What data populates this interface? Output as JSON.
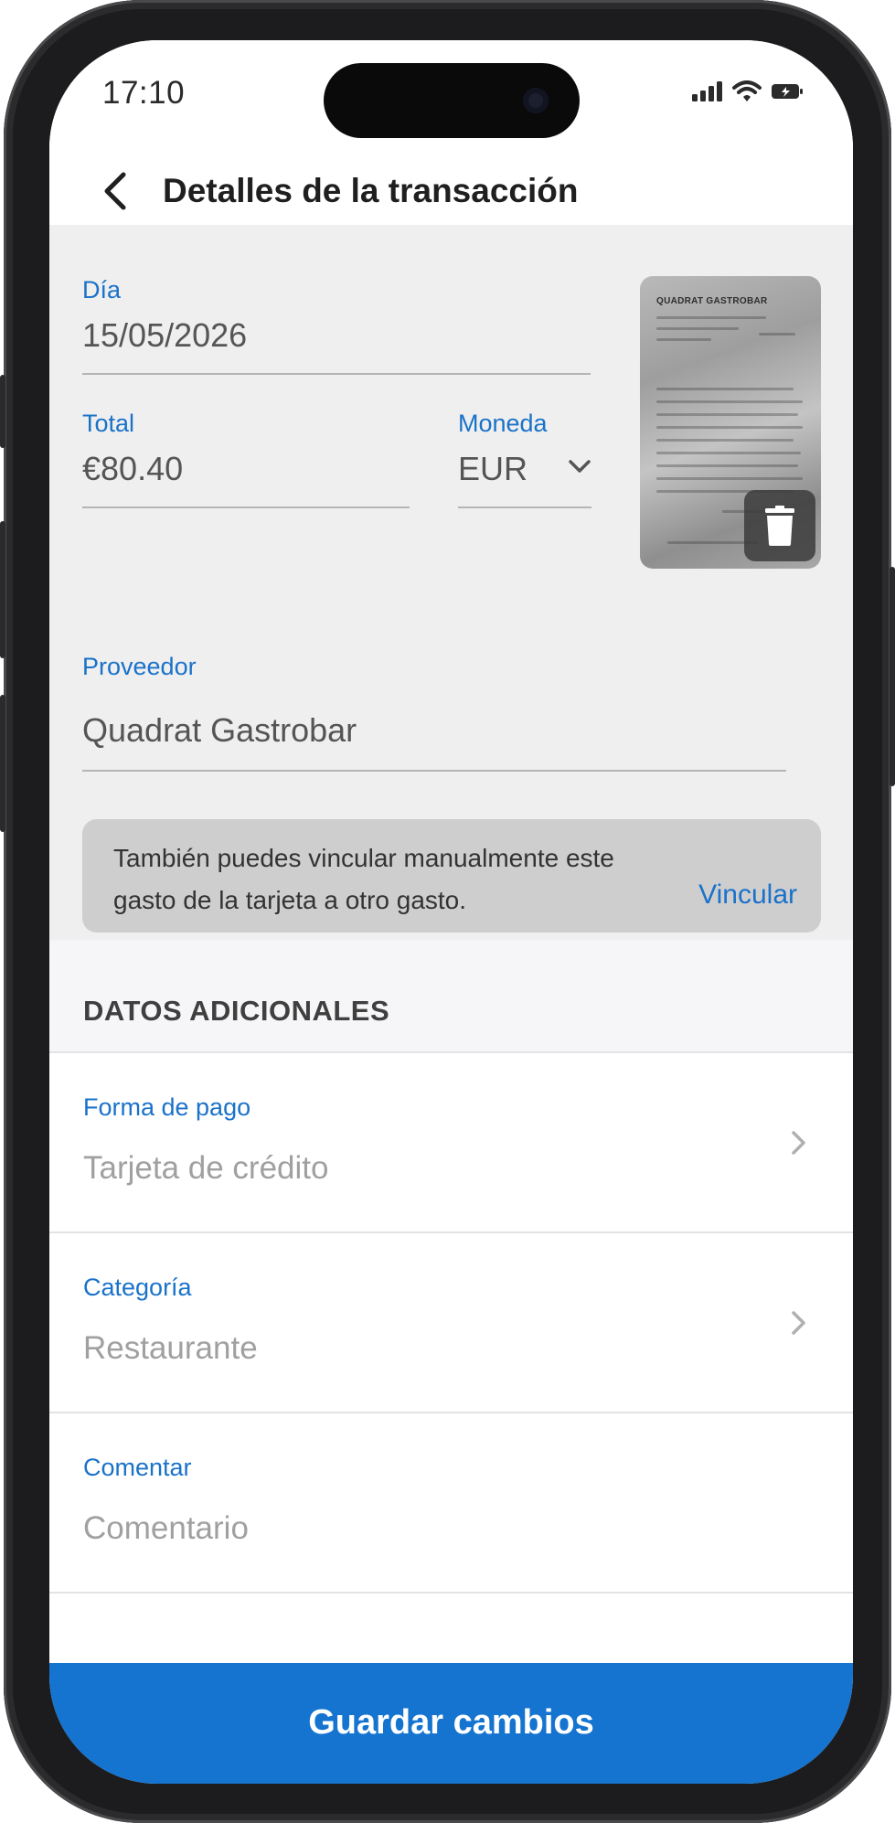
{
  "status_bar": {
    "time": "17:10"
  },
  "header": {
    "title": "Detalles de la transacción"
  },
  "form": {
    "day": {
      "label": "Día",
      "value": "15/05/2026"
    },
    "total": {
      "label": "Total",
      "value": "€80.40"
    },
    "currency": {
      "label": "Moneda",
      "value": "EUR"
    },
    "provider": {
      "label": "Proveedor",
      "value": "Quadrat Gastrobar"
    }
  },
  "receipt": {
    "header_text": "QUADRAT GASTROBAR"
  },
  "info_box": {
    "text": "También puedes vincular manualmente este gasto de la tarjeta a otro gasto.",
    "link_label": "Vincular"
  },
  "additional": {
    "title": "DATOS ADICIONALES",
    "rows": [
      {
        "label": "Forma de pago",
        "value": "Tarjeta de crédito"
      },
      {
        "label": "Categoría",
        "value": "Restaurante"
      },
      {
        "label": "Comentar",
        "value": "Comentario"
      }
    ]
  },
  "footer": {
    "save_label": "Guardar cambios"
  },
  "colors": {
    "accent": "#1474cf",
    "label_blue": "#1a72c9",
    "grey_bg": "#efefef"
  },
  "icons": [
    "back-icon",
    "signal-icon",
    "wifi-icon",
    "battery-icon",
    "chevron-down-icon",
    "trash-icon",
    "chevron-right-icon"
  ]
}
